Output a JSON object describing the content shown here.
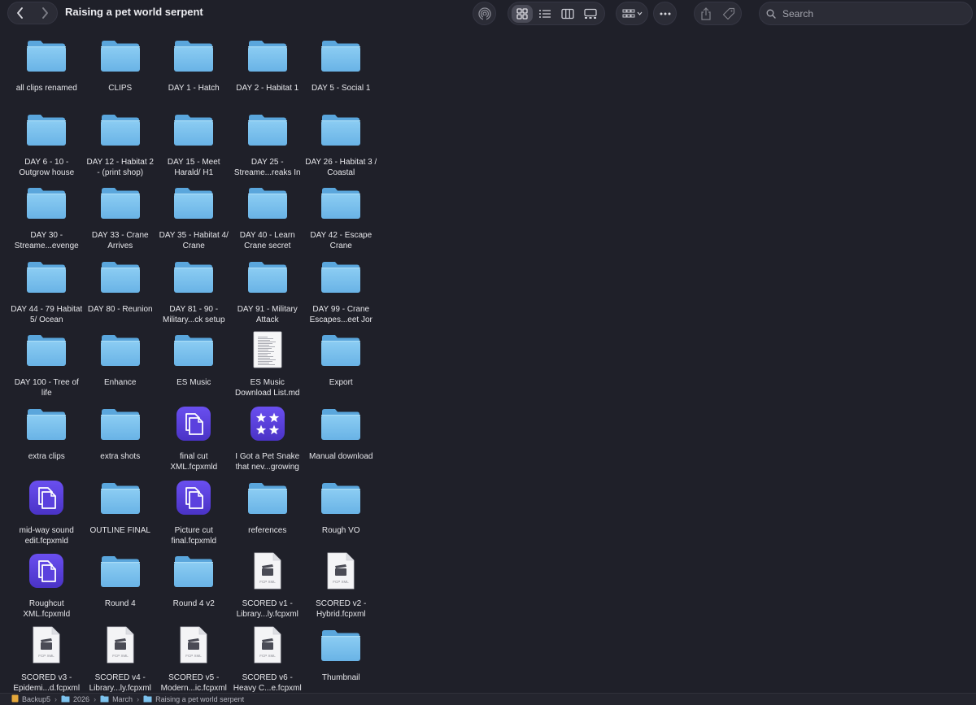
{
  "window": {
    "title": "Raising a pet world serpent",
    "search_placeholder": "Search"
  },
  "toolbar_icons": [
    "back-icon",
    "forward-icon",
    "airdrop-icon",
    "icon-view-icon",
    "list-view-icon",
    "column-view-icon",
    "gallery-view-icon",
    "group-icon",
    "more-icon",
    "share-icon",
    "tag-icon",
    "search-icon"
  ],
  "colors": {
    "background": "#1f2029",
    "folder": "#7cc2ee",
    "app_icon": "#5a3fd6"
  },
  "items": [
    {
      "name": "all clips renamed",
      "type": "folder"
    },
    {
      "name": "CLIPS",
      "type": "folder"
    },
    {
      "name": "DAY 1 - Hatch",
      "type": "folder"
    },
    {
      "name": "DAY 2 - Habitat 1",
      "type": "folder"
    },
    {
      "name": "DAY 5 - Social 1",
      "type": "folder"
    },
    {
      "name": "DAY 6 - 10 - Outgrow house",
      "type": "folder"
    },
    {
      "name": "DAY 12 - Habitat 2 - (print shop)",
      "type": "folder"
    },
    {
      "name": "DAY 15 - Meet Harald/ H1",
      "type": "folder"
    },
    {
      "name": "DAY 25 - Streame...reaks In",
      "type": "folder"
    },
    {
      "name": "DAY 26 - Habitat 3 / Coastal",
      "type": "folder"
    },
    {
      "name": "DAY 30 - Streame...evenge",
      "type": "folder"
    },
    {
      "name": "DAY 33 - Crane Arrives",
      "type": "folder"
    },
    {
      "name": "DAY 35 - Habitat 4/ Crane",
      "type": "folder"
    },
    {
      "name": "DAY 40 - Learn Crane secret",
      "type": "folder"
    },
    {
      "name": "DAY 42 - Escape Crane",
      "type": "folder"
    },
    {
      "name": "DAY 44 - 79 Habitat 5/ Ocean",
      "type": "folder"
    },
    {
      "name": "DAY 80 - Reunion",
      "type": "folder"
    },
    {
      "name": "DAY 81 - 90 - Military...ck setup",
      "type": "folder"
    },
    {
      "name": "DAY 91 - Military Attack",
      "type": "folder"
    },
    {
      "name": "DAY 99 - Crane Escapes...eet Jor",
      "type": "folder"
    },
    {
      "name": "DAY 100 - Tree of life",
      "type": "folder"
    },
    {
      "name": "Enhance",
      "type": "folder"
    },
    {
      "name": "ES Music",
      "type": "folder"
    },
    {
      "name": "ES Music Download List.md",
      "type": "doc"
    },
    {
      "name": "Export",
      "type": "folder"
    },
    {
      "name": "extra clips",
      "type": "folder"
    },
    {
      "name": "extra shots",
      "type": "folder"
    },
    {
      "name": "final cut XML.fcpxmld",
      "type": "fcpxmld"
    },
    {
      "name": "I Got a Pet Snake that nev...growing",
      "type": "imovie"
    },
    {
      "name": "Manual download",
      "type": "folder"
    },
    {
      "name": "mid-way sound edit.fcpxmld",
      "type": "fcpxmld"
    },
    {
      "name": "OUTLINE FINAL",
      "type": "folder"
    },
    {
      "name": "Picture cut final.fcpxmld",
      "type": "fcpxmld"
    },
    {
      "name": "references",
      "type": "folder"
    },
    {
      "name": "Rough VO",
      "type": "folder"
    },
    {
      "name": "Roughcut XML.fcpxmld",
      "type": "fcpxmld"
    },
    {
      "name": "Round 4",
      "type": "folder"
    },
    {
      "name": "Round 4 v2",
      "type": "folder"
    },
    {
      "name": "SCORED v1 - Library...ly.fcpxml",
      "type": "fcpxml"
    },
    {
      "name": "SCORED v2 - Hybrid.fcpxml",
      "type": "fcpxml"
    },
    {
      "name": "SCORED v3 - Epidemi...d.fcpxml",
      "type": "fcpxml"
    },
    {
      "name": "SCORED v4 - Library...ly.fcpxml",
      "type": "fcpxml"
    },
    {
      "name": "SCORED v5 - Modern...ic.fcpxml",
      "type": "fcpxml"
    },
    {
      "name": "SCORED v6 - Heavy C...e.fcpxml",
      "type": "fcpxml"
    },
    {
      "name": "Thumbnail",
      "type": "folder"
    }
  ],
  "fcpxml_badge": "FCP XML",
  "path": [
    {
      "label": "Backup5",
      "icon": "drive-icon"
    },
    {
      "label": "2026",
      "icon": "folder-icon"
    },
    {
      "label": "March",
      "icon": "folder-icon"
    },
    {
      "label": "Raising a pet world serpent",
      "icon": "folder-icon"
    }
  ]
}
